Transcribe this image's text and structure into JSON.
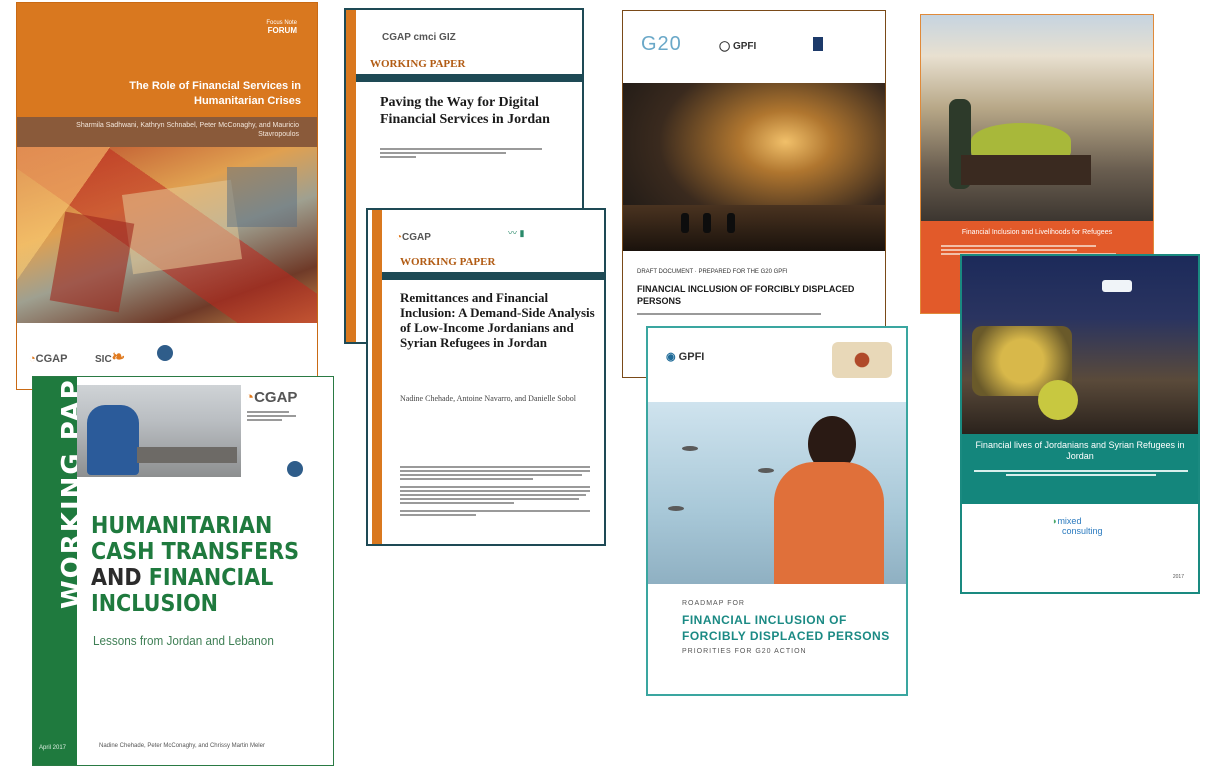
{
  "c1": {
    "series_line1": "Focus Note",
    "series_line2": "FORUM",
    "title": "The Role of Financial Services in Humanitarian Crises",
    "authors": "Sharmila Sadhwani, Kathryn Schnabel, Peter McConaghy, and Mauricio Stavropoulos",
    "logo_a": "CGAP",
    "logo_b": "SIC"
  },
  "c2": {
    "spine": "WORKING PAPER",
    "logo": "CGAP",
    "title_line1": "HUMANITARIAN",
    "title_line2": "CASH TRANSFERS",
    "title_line3_a": "AND ",
    "title_line3_b": "FINANCIAL",
    "title_line4": "INCLUSION",
    "subtitle": "Lessons from Jordan and Lebanon",
    "date": "April 2017",
    "authors": "Nadine Chehade, Peter McConaghy, and Chrissy Martin Meler"
  },
  "c3": {
    "logos": "CGAP  cmci  GIZ",
    "label": "WORKING PAPER",
    "title": "Paving the Way for Digital Financial Services in Jordan"
  },
  "c4": {
    "logo": "CGAP",
    "label": "WORKING PAPER",
    "title": "Remittances and Financial Inclusion: A Demand-Side Analysis of Low-Income Jordanians and Syrian Refugees in Jordan",
    "authors": "Nadine Chehade, Antoine Navarro, and Danielle Sobol"
  },
  "c5": {
    "logo_a": "G20",
    "logo_b": "GPFI",
    "overline": "DRAFT DOCUMENT · PREPARED FOR THE G20 GPFI",
    "title": "FINANCIAL INCLUSION OF FORCIBLY DISPLACED PERSONS"
  },
  "c6": {
    "title": "Financial Inclusion and Livelihoods for Refugees"
  },
  "c7": {
    "logo": "GPFI",
    "overline": "ROADMAP FOR",
    "title": "FINANCIAL INCLUSION OF FORCIBLY DISPLACED PERSONS",
    "subtitle": "PRIORITIES FOR G20 ACTION"
  },
  "c8": {
    "title": "Financial lives of Jordanians and Syrian Refugees in Jordan",
    "logo_line1": "mixed",
    "logo_line2": "consulting",
    "date": "2017"
  }
}
